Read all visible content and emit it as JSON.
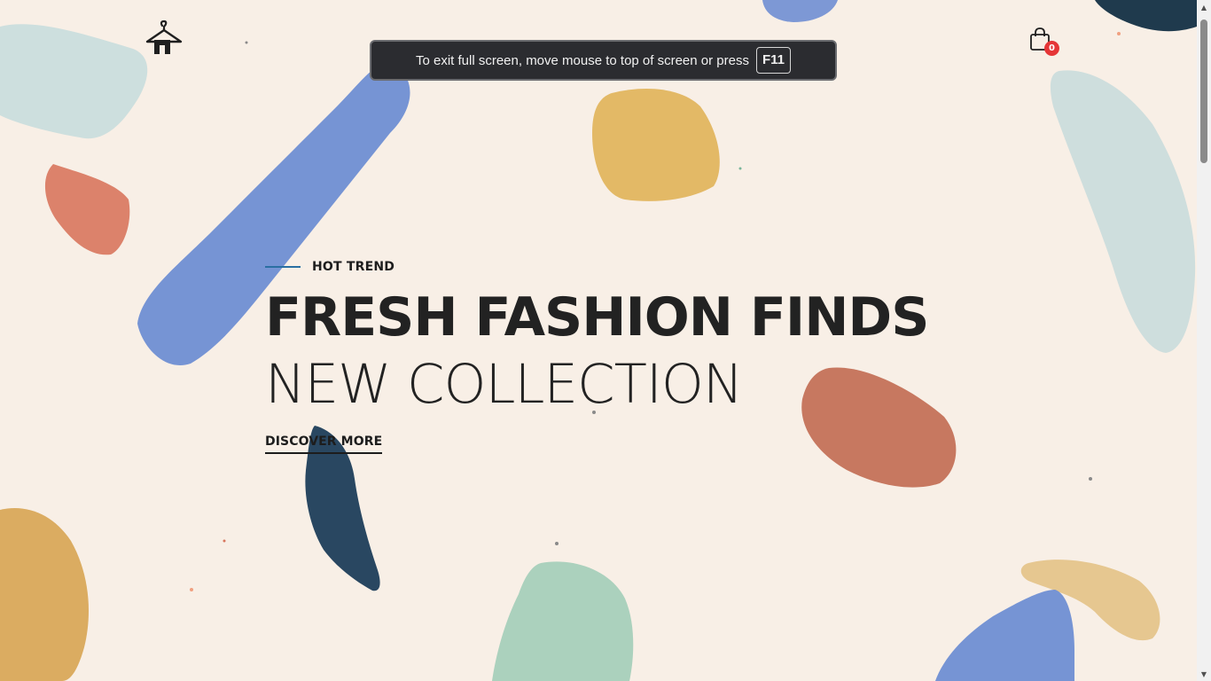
{
  "header": {
    "logo_icon": "hanger-house-icon",
    "cart_icon": "shopping-bag-icon",
    "cart_count": "0"
  },
  "fullscreen_notice": {
    "message": "To exit full screen, move mouse to top of screen or press",
    "key": "F11"
  },
  "hero": {
    "eyebrow": "HOT TREND",
    "title_bold": "FRESH FASHION FINDS",
    "title_light": "NEW COLLECTION",
    "cta_label": "DISCOVER MORE"
  },
  "colors": {
    "background": "#f8efe6",
    "accent_line": "#2a6fa2",
    "badge": "#e53637",
    "text": "#222222"
  }
}
